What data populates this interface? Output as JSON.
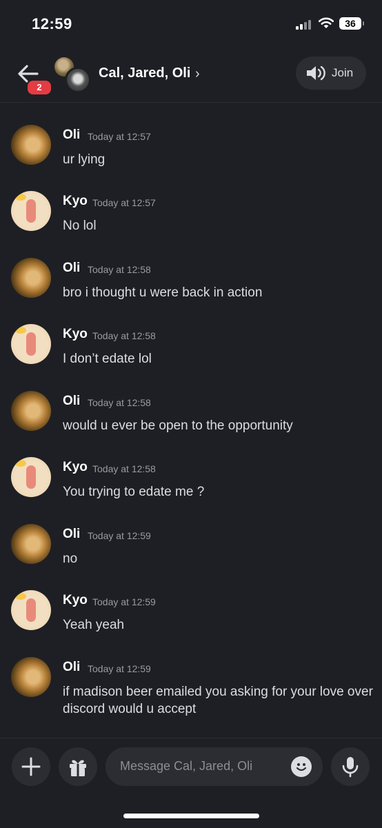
{
  "status_bar": {
    "time": "12:59",
    "battery": "36"
  },
  "header": {
    "unread_badge": "2",
    "title": "Cal, Jared, Oli",
    "chevron": "›",
    "join_label": "Join"
  },
  "messages": [
    {
      "author": "Oli",
      "timestamp": "Today at 12:57",
      "text": "ur lying"
    },
    {
      "author": "Kyo",
      "timestamp": "Today at 12:57",
      "text": "No lol"
    },
    {
      "author": "Oli",
      "timestamp": "Today at 12:58",
      "text": "bro i thought u were back in action"
    },
    {
      "author": "Kyo",
      "timestamp": "Today at 12:58",
      "text": "I don’t edate lol"
    },
    {
      "author": "Oli",
      "timestamp": "Today at 12:58",
      "text": "would u ever be open to the opportunity"
    },
    {
      "author": "Kyo",
      "timestamp": "Today at 12:58",
      "text": "You trying to edate me ?"
    },
    {
      "author": "Oli",
      "timestamp": "Today at 12:59",
      "text": "no"
    },
    {
      "author": "Kyo",
      "timestamp": "Today at 12:59",
      "text": "Yeah yeah"
    },
    {
      "author": "Oli",
      "timestamp": "Today at 12:59",
      "text": "if madison beer emailed you asking for your love over discord would u accept"
    }
  ],
  "composer": {
    "placeholder": "Message Cal, Jared, Oli"
  },
  "icons": {
    "back": "arrow-left-icon",
    "speaker": "speaker-icon",
    "plus": "plus-icon",
    "gift": "gift-icon",
    "emoji": "emoji-icon",
    "mic": "microphone-icon"
  },
  "colors": {
    "background": "#1e1f24",
    "surface": "#2b2d33",
    "badge": "#e53b43",
    "timestamp": "#9a9ba1"
  }
}
